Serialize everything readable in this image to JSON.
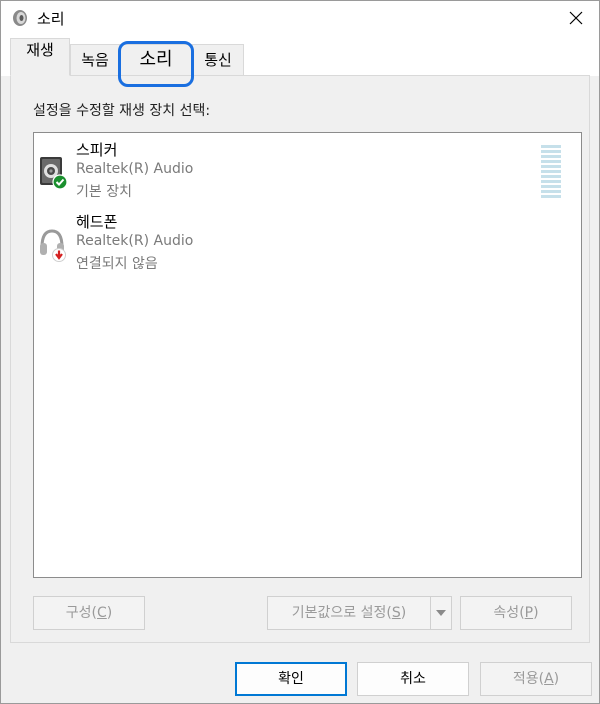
{
  "window": {
    "title": "소리",
    "title_icon": "speaker-icon",
    "close_icon": "close-icon"
  },
  "tabs": [
    {
      "label": "재생",
      "active": true
    },
    {
      "label": "녹음",
      "active": false
    },
    {
      "label": "소리",
      "active": false,
      "highlighted": true
    },
    {
      "label": "통신",
      "active": false
    }
  ],
  "content": {
    "instruction": "설정을 수정할 재생 장치 선택:",
    "devices": [
      {
        "name": "스피커",
        "driver": "Realtek(R) Audio",
        "status": "기본 장치",
        "icon": "speaker-device-icon",
        "badge": "default-check-icon"
      },
      {
        "name": "헤드폰",
        "driver": "Realtek(R) Audio",
        "status": "연결되지 않음",
        "icon": "headphone-device-icon",
        "badge": "disconnected-arrow-icon"
      }
    ],
    "level_meter_segments": 12
  },
  "buttons": {
    "configure_text": "구성",
    "configure_key": "C",
    "set_default_text": "기본값으로 설정",
    "set_default_key": "S",
    "properties_text": "속성",
    "properties_key": "P",
    "ok": "확인",
    "cancel": "취소",
    "apply_text": "적용",
    "apply_key": "A"
  },
  "colors": {
    "accent": "#0078d4",
    "highlight_ring": "#1a6fe0",
    "check_green": "#1a8f2e",
    "disconnected_red": "#d42020",
    "disabled_text": "#9a9a9a"
  }
}
